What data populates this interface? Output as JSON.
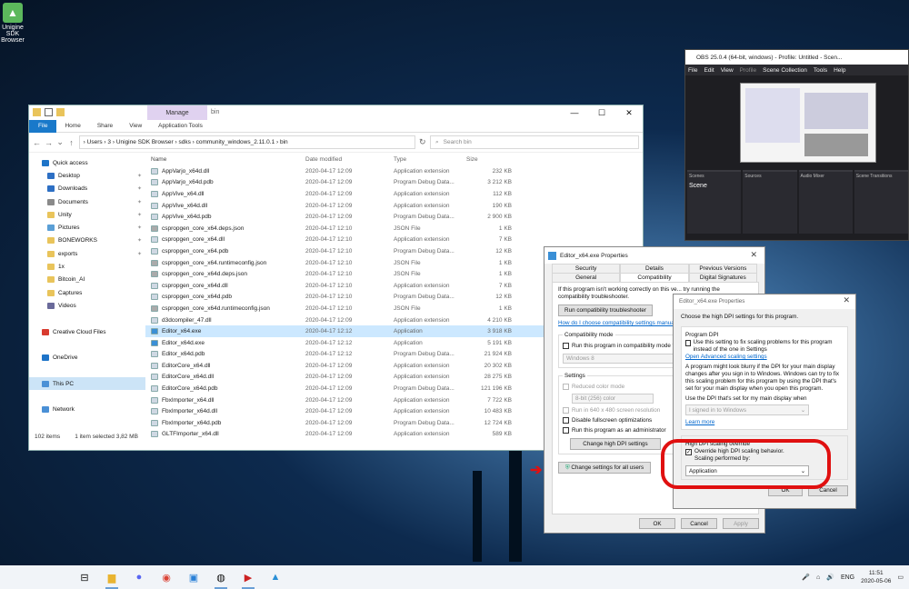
{
  "desktop": {
    "icon_label_1": "Unigine SDK",
    "icon_label_2": "Browser"
  },
  "explorer": {
    "manage_tab": "Manage",
    "window_name": "bin",
    "tabs": [
      "File",
      "Home",
      "Share",
      "View",
      "Application Tools"
    ],
    "breadcrumb": [
      "Users",
      "3",
      "Unigine SDK Browser",
      "sdks",
      "community_windows_2.11.0.1",
      "bin"
    ],
    "search_placeholder": "Search bin",
    "nav": [
      {
        "label": "Quick access",
        "sub": false,
        "color": "#1e74c8"
      },
      {
        "label": "Desktop",
        "sub": true,
        "color": "#2d6fc4",
        "pin": true
      },
      {
        "label": "Downloads",
        "sub": true,
        "color": "#2d6fc4",
        "pin": true
      },
      {
        "label": "Documents",
        "sub": true,
        "color": "#8a8a8a",
        "pin": true
      },
      {
        "label": "Unity",
        "sub": true,
        "color": "#e9c45b",
        "pin": true
      },
      {
        "label": "Pictures",
        "sub": true,
        "color": "#5a9fd6",
        "pin": true
      },
      {
        "label": "BONEWORKS",
        "sub": true,
        "color": "#e9c45b",
        "pin": true
      },
      {
        "label": "exports",
        "sub": true,
        "color": "#e9c45b",
        "pin": true
      },
      {
        "label": "1x",
        "sub": true,
        "color": "#e9c45b"
      },
      {
        "label": "Bitcoin_AI",
        "sub": true,
        "color": "#e9c45b"
      },
      {
        "label": "Captures",
        "sub": true,
        "color": "#e9c45b"
      },
      {
        "label": "Videos",
        "sub": true,
        "color": "#6a6a9a"
      },
      {
        "label": "",
        "sub": false,
        "color": ""
      },
      {
        "label": "Creative Cloud Files",
        "sub": false,
        "color": "#d83b2f"
      },
      {
        "label": "",
        "sub": false,
        "color": ""
      },
      {
        "label": "OneDrive",
        "sub": false,
        "color": "#1e74c8"
      },
      {
        "label": "",
        "sub": false,
        "color": ""
      },
      {
        "label": "This PC",
        "sub": false,
        "color": "#4a90d6",
        "sel": true
      },
      {
        "label": "",
        "sub": false,
        "color": ""
      },
      {
        "label": "Network",
        "sub": false,
        "color": "#4a90d6"
      }
    ],
    "columns": [
      "Name",
      "Date modified",
      "Type",
      "Size"
    ],
    "files": [
      [
        "AppVarjo_x64d.dll",
        "2020-04-17 12:09",
        "Application extension",
        "232 KB"
      ],
      [
        "AppVarjo_x64d.pdb",
        "2020-04-17 12:09",
        "Program Debug Data...",
        "3 212 KB"
      ],
      [
        "AppVive_x64.dll",
        "2020-04-17 12:09",
        "Application extension",
        "112 KB"
      ],
      [
        "AppVive_x64d.dll",
        "2020-04-17 12:09",
        "Application extension",
        "190 KB"
      ],
      [
        "AppVive_x64d.pdb",
        "2020-04-17 12:09",
        "Program Debug Data...",
        "2 900 KB"
      ],
      [
        "cspropgen_core_x64.deps.json",
        "2020-04-17 12:10",
        "JSON File",
        "1 KB"
      ],
      [
        "cspropgen_core_x64.dll",
        "2020-04-17 12:10",
        "Application extension",
        "7 KB"
      ],
      [
        "cspropgen_core_x64.pdb",
        "2020-04-17 12:10",
        "Program Debug Data...",
        "12 KB"
      ],
      [
        "cspropgen_core_x64.runtimeconfig.json",
        "2020-04-17 12:10",
        "JSON File",
        "1 KB"
      ],
      [
        "cspropgen_core_x64d.deps.json",
        "2020-04-17 12:10",
        "JSON File",
        "1 KB"
      ],
      [
        "cspropgen_core_x64d.dll",
        "2020-04-17 12:10",
        "Application extension",
        "7 KB"
      ],
      [
        "cspropgen_core_x64d.pdb",
        "2020-04-17 12:10",
        "Program Debug Data...",
        "12 KB"
      ],
      [
        "cspropgen_core_x64d.runtimeconfig.json",
        "2020-04-17 12:10",
        "JSON File",
        "1 KB"
      ],
      [
        "d3dcompiler_47.dll",
        "2020-04-17 12:09",
        "Application extension",
        "4 210 KB"
      ],
      [
        "Editor_x64.exe",
        "2020-04-17 12:12",
        "Application",
        "3 918 KB"
      ],
      [
        "Editor_x64d.exe",
        "2020-04-17 12:12",
        "Application",
        "5 191 KB"
      ],
      [
        "Editor_x64d.pdb",
        "2020-04-17 12:12",
        "Program Debug Data...",
        "21 924 KB"
      ],
      [
        "EditorCore_x64.dll",
        "2020-04-17 12:09",
        "Application extension",
        "20 302 KB"
      ],
      [
        "EditorCore_x64d.dll",
        "2020-04-17 12:09",
        "Application extension",
        "28 275 KB"
      ],
      [
        "EditorCore_x64d.pdb",
        "2020-04-17 12:09",
        "Program Debug Data...",
        "121 196 KB"
      ],
      [
        "FbxImporter_x64.dll",
        "2020-04-17 12:09",
        "Application extension",
        "7 722 KB"
      ],
      [
        "FbxImporter_x64d.dll",
        "2020-04-17 12:09",
        "Application extension",
        "10 483 KB"
      ],
      [
        "FbxImporter_x64d.pdb",
        "2020-04-17 12:09",
        "Program Debug Data...",
        "12 724 KB"
      ],
      [
        "GLTFImporter_x64.dll",
        "2020-04-17 12:09",
        "Application extension",
        "589 KB"
      ]
    ],
    "selected_index": 14,
    "status_count": "102 items",
    "status_selected": "1 item selected  3,82 MB"
  },
  "obs": {
    "title": "OBS 25.0.4 (64-bit, windows) - Profile: Untitled - Scen...",
    "menu": [
      "File",
      "Edit",
      "View",
      "Profile",
      "Scene Collection",
      "Tools",
      "Help"
    ],
    "dock_scenes": "Scenes",
    "dock_sources": "Sources",
    "dock_mixer": "Audio Mixer",
    "dock_transitions": "Scene Transitions",
    "scene_name": "Scene"
  },
  "props": {
    "title": "Editor_x64.exe Properties",
    "tabs_row1": [
      "Security",
      "Details",
      "Previous Versions"
    ],
    "tabs_row2": [
      "General",
      "Compatibility",
      "Digital Signatures"
    ],
    "intro": "If this program isn't working correctly on this ve... try running the compatibility troubleshooter.",
    "troubleshooter_btn": "Run compatibility troubleshooter",
    "how_link": "How do I choose compatibility settings manua...",
    "compat_group": "Compatibility mode",
    "compat_chk": "Run this program in compatibility mode fo...",
    "compat_os": "Windows 8",
    "settings_group": "Settings",
    "reduced_color": "Reduced color mode",
    "color_option": "8-bit (256) color",
    "res_640": "Run in 640 x 480 screen resolution",
    "disable_fs": "Disable fullscreen optimizations",
    "run_admin": "Run this program as an administrator",
    "change_dpi_btn": "Change high DPI settings",
    "all_users_btn": "Change settings for all users",
    "ok": "OK",
    "cancel": "Cancel",
    "apply": "Apply"
  },
  "dpi": {
    "title": "Editor_x64.exe Properties",
    "heading": "Choose the high DPI settings for this program.",
    "group1": "Program DPI",
    "chk1": "Use this setting to fix scaling problems for this program instead of the one in Settings",
    "adv_link": "Open Advanced scaling settings",
    "para": "A program might look blurry if the DPI for your main display changes after you sign in to Windows. Windows can try to fix this scaling problem for this program by using the DPI that's set for your main display when you open this program.",
    "use_dpi": "Use the DPI that's set for my main display when",
    "signed_in": "I signed in to Windows",
    "learn": "Learn more",
    "group2": "High DPI scaling override",
    "override_chk": "Override high DPI scaling behavior.",
    "scaling_by": "Scaling performed by:",
    "scaling_value": "Application",
    "ok": "OK",
    "cancel": "Cancel"
  },
  "taskbar": {
    "tray_lang": "ENG",
    "time": "11:51",
    "date": "2020-05-06"
  },
  "colors": {
    "accent": "#1979ca",
    "annotation": "#e01010"
  }
}
